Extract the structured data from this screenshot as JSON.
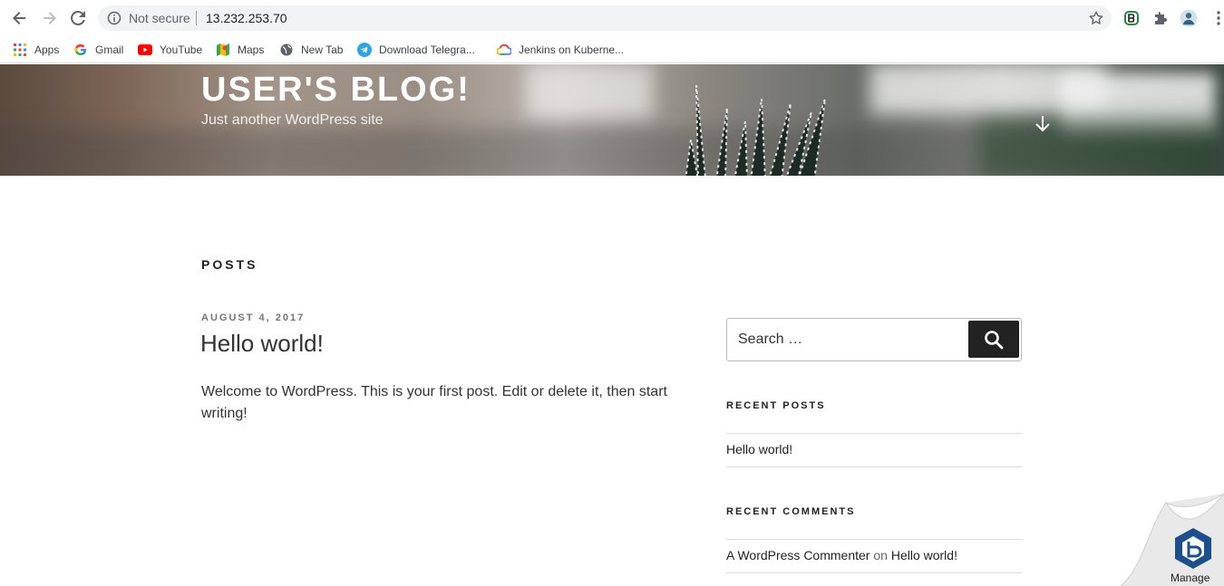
{
  "browser": {
    "security_label": "Not secure",
    "url": "13.232.253.70",
    "bookmarks": [
      {
        "label": "Apps",
        "icon": "apps-grid-icon"
      },
      {
        "label": "Gmail",
        "icon": "google-g-icon"
      },
      {
        "label": "YouTube",
        "icon": "youtube-icon"
      },
      {
        "label": "Maps",
        "icon": "maps-icon"
      },
      {
        "label": "New Tab",
        "icon": "globe-icon"
      },
      {
        "label": "Download Telegra...",
        "icon": "telegram-icon"
      },
      {
        "label": "Jenkins on Kuberne...",
        "icon": "google-cloud-icon"
      }
    ]
  },
  "site": {
    "title": "USER'S BLOG!",
    "description": "Just another WordPress site"
  },
  "main": {
    "section_heading": "POSTS",
    "post": {
      "date": "AUGUST 4, 2017",
      "title": "Hello world!",
      "body": "Welcome to WordPress. This is your first post. Edit or delete it, then start writing!"
    }
  },
  "sidebar": {
    "search_placeholder": "Search …",
    "recent_posts_title": "RECENT POSTS",
    "recent_posts": [
      "Hello world!"
    ],
    "recent_comments_title": "RECENT COMMENTS",
    "recent_comment": {
      "author": "A WordPress Commenter",
      "on": "on",
      "post": "Hello world!"
    }
  },
  "overlay": {
    "manage_label": "Manage"
  },
  "colors": {
    "accent_dark": "#222222",
    "chrome_gray": "#5f6368",
    "bitnami_blue": "#1d4f8c"
  }
}
